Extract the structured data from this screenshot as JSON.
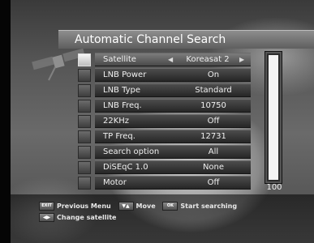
{
  "title": "Automatic Channel Search",
  "menu": [
    {
      "label": "Satellite",
      "value": "Koreasat 2",
      "active": true
    },
    {
      "label": "LNB Power",
      "value": "On"
    },
    {
      "label": "LNB Type",
      "value": "Standard"
    },
    {
      "label": "LNB Freq.",
      "value": "10750"
    },
    {
      "label": "22KHz",
      "value": "Off"
    },
    {
      "label": "TP Freq.",
      "value": "12731"
    },
    {
      "label": "Search option",
      "value": "All"
    },
    {
      "label": "DiSEqC 1.0",
      "value": "None"
    },
    {
      "label": "Motor",
      "value": "Off"
    }
  ],
  "progress": {
    "value": 100,
    "label": "100"
  },
  "help": {
    "exit_key": "EXIT",
    "prev_menu": "Previous Menu",
    "move": "Move",
    "ok_key": "OK",
    "start_search": "Start searching",
    "change_satellite": "Change satellite"
  },
  "icons": {
    "left_arrow": "arrow-left-icon",
    "right_arrow": "arrow-right-icon",
    "updown": "updown-key-icon",
    "leftright": "leftright-key-icon",
    "satellite_art": "satellite-icon"
  }
}
